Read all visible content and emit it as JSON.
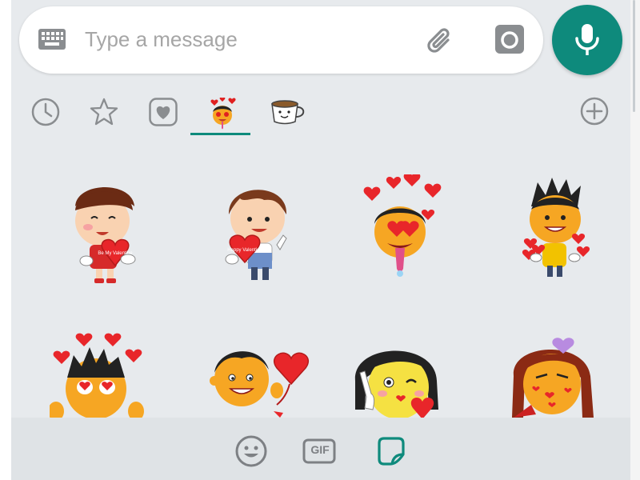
{
  "composer": {
    "placeholder": "Type a message",
    "keyboard_icon": "keyboard-icon",
    "attach_icon": "paperclip-icon",
    "camera_icon": "camera-icon",
    "mic_icon": "microphone-icon"
  },
  "colors": {
    "accent": "#0e8a7c",
    "panel_bg": "#e7eaed",
    "icon_gray": "#8a8d90"
  },
  "sticker_tabs": [
    {
      "name": "recent",
      "icon": "clock-icon"
    },
    {
      "name": "favorites",
      "icon": "star-icon"
    },
    {
      "name": "love",
      "icon": "heart-icon"
    },
    {
      "name": "valentine-pack",
      "icon": "sticker-pack-icon",
      "selected": true
    },
    {
      "name": "coffee-pack",
      "icon": "coffee-cup-icon"
    }
  ],
  "add_pack_icon": "plus-circle-icon",
  "stickers": {
    "row1": [
      {
        "heart_text": "Be My Valentine"
      },
      {
        "heart_text": "Happy Valentine"
      },
      {
        "heart_text": ""
      },
      {
        "heart_text": ""
      }
    ],
    "row2": [
      {
        "heart_text": ""
      },
      {
        "heart_text": ""
      },
      {
        "heart_text": ""
      },
      {
        "heart_text": ""
      }
    ]
  },
  "bottom_bar": {
    "emoji_icon": "smiley-icon",
    "gif_label": "GIF",
    "sticker_icon": "sticker-icon"
  }
}
